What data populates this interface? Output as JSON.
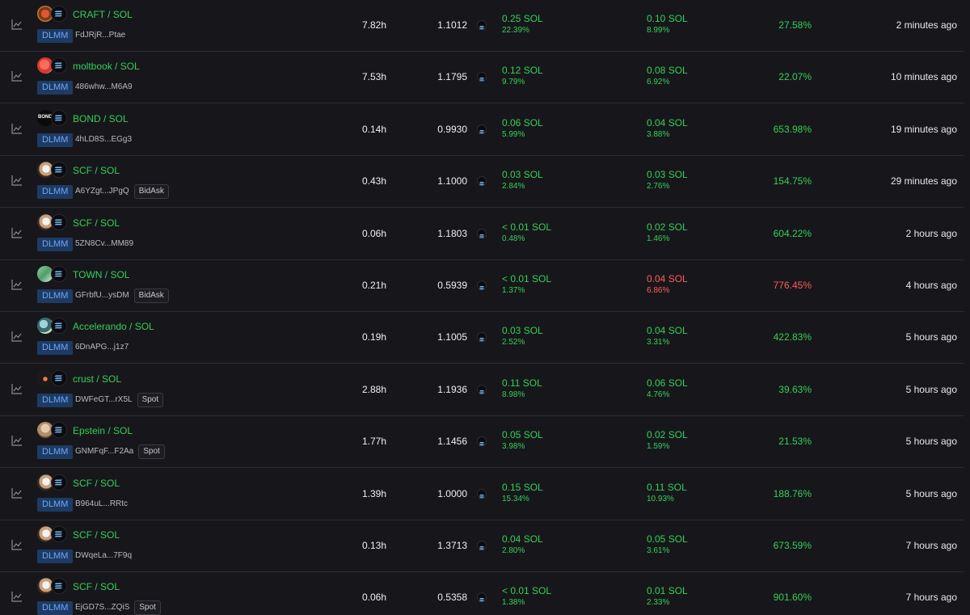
{
  "colors": {
    "background": "#17171b",
    "positive": "#34d058",
    "negative": "#ff5c5c",
    "badge_bg": "#1d3b63",
    "badge_text": "#6ea8ff"
  },
  "rows": [
    {
      "pair": "CRAFT / SOL",
      "token_icon": "craft-token-icon",
      "badge": "DLMM",
      "address": "FdJRjR...Ptae",
      "strategy": "",
      "duration": "7.82h",
      "price": "1.1012",
      "fee": "0.25 SOL",
      "fee_pct": "22.39%",
      "pnl": "0.10 SOL",
      "pnl_pct": "8.99%",
      "pnl_status": "positive",
      "apr": "27.58%",
      "apr_status": "positive",
      "age": "2 minutes ago"
    },
    {
      "pair": "moltbook / SOL",
      "token_icon": "moltbook-token-icon",
      "badge": "DLMM",
      "address": "486whw...M6A9",
      "strategy": "",
      "duration": "7.53h",
      "price": "1.1795",
      "fee": "0.12 SOL",
      "fee_pct": "9.79%",
      "pnl": "0.08 SOL",
      "pnl_pct": "6.92%",
      "pnl_status": "positive",
      "apr": "22.07%",
      "apr_status": "positive",
      "age": "10 minutes ago"
    },
    {
      "pair": "BOND / SOL",
      "token_icon": "bond-token-icon",
      "badge": "DLMM",
      "address": "4hLD8S...EGg3",
      "strategy": "",
      "duration": "0.14h",
      "price": "0.9930",
      "fee": "0.06 SOL",
      "fee_pct": "5.99%",
      "pnl": "0.04 SOL",
      "pnl_pct": "3.88%",
      "pnl_status": "positive",
      "apr": "653.98%",
      "apr_status": "positive",
      "age": "19 minutes ago"
    },
    {
      "pair": "SCF / SOL",
      "token_icon": "scf-token-icon",
      "badge": "DLMM",
      "address": "A6YZgt...JPgQ",
      "strategy": "BidAsk",
      "duration": "0.43h",
      "price": "1.1000",
      "fee": "0.03 SOL",
      "fee_pct": "2.84%",
      "pnl": "0.03 SOL",
      "pnl_pct": "2.76%",
      "pnl_status": "positive",
      "apr": "154.75%",
      "apr_status": "positive",
      "age": "29 minutes ago"
    },
    {
      "pair": "SCF / SOL",
      "token_icon": "scf-token-icon",
      "badge": "DLMM",
      "address": "5ZN8Cv...MM89",
      "strategy": "",
      "duration": "0.06h",
      "price": "1.1803",
      "fee": "< 0.01 SOL",
      "fee_pct": "0.48%",
      "pnl": "0.02 SOL",
      "pnl_pct": "1.46%",
      "pnl_status": "positive",
      "apr": "604.22%",
      "apr_status": "positive",
      "age": "2 hours ago"
    },
    {
      "pair": "TOWN / SOL",
      "token_icon": "town-token-icon",
      "badge": "DLMM",
      "address": "GFrbfU...ysDM",
      "strategy": "BidAsk",
      "duration": "0.21h",
      "price": "0.5939",
      "fee": "< 0.01 SOL",
      "fee_pct": "1.37%",
      "pnl": "0.04 SOL",
      "pnl_pct": "6.86%",
      "pnl_status": "negative",
      "apr": "776.45%",
      "apr_status": "negative",
      "age": "4 hours ago"
    },
    {
      "pair": "Accelerando / SOL",
      "token_icon": "accelerando-token-icon",
      "badge": "DLMM",
      "address": "6DnAPG...j1z7",
      "strategy": "",
      "duration": "0.19h",
      "price": "1.1005",
      "fee": "0.03 SOL",
      "fee_pct": "2.52%",
      "pnl": "0.04 SOL",
      "pnl_pct": "3.31%",
      "pnl_status": "positive",
      "apr": "422.83%",
      "apr_status": "positive",
      "age": "5 hours ago"
    },
    {
      "pair": "crust / SOL",
      "token_icon": "crust-token-icon",
      "badge": "DLMM",
      "address": "DWFeGT...rX5L",
      "strategy": "Spot",
      "duration": "2.88h",
      "price": "1.1936",
      "fee": "0.11 SOL",
      "fee_pct": "8.98%",
      "pnl": "0.06 SOL",
      "pnl_pct": "4.76%",
      "pnl_status": "positive",
      "apr": "39.63%",
      "apr_status": "positive",
      "age": "5 hours ago"
    },
    {
      "pair": "Epstein / SOL",
      "token_icon": "epstein-token-icon",
      "badge": "DLMM",
      "address": "GNMFqF...F2Aa",
      "strategy": "Spot",
      "duration": "1.77h",
      "price": "1.1456",
      "fee": "0.05 SOL",
      "fee_pct": "3.98%",
      "pnl": "0.02 SOL",
      "pnl_pct": "1.59%",
      "pnl_status": "positive",
      "apr": "21.53%",
      "apr_status": "positive",
      "age": "5 hours ago"
    },
    {
      "pair": "SCF / SOL",
      "token_icon": "scf-token-icon",
      "badge": "DLMM",
      "address": "B964uL...RRtc",
      "strategy": "",
      "duration": "1.39h",
      "price": "1.0000",
      "fee": "0.15 SOL",
      "fee_pct": "15.34%",
      "pnl": "0.11 SOL",
      "pnl_pct": "10.93%",
      "pnl_status": "positive",
      "apr": "188.76%",
      "apr_status": "positive",
      "age": "5 hours ago"
    },
    {
      "pair": "SCF / SOL",
      "token_icon": "scf-token-icon",
      "badge": "DLMM",
      "address": "DWqeLa...7F9q",
      "strategy": "",
      "duration": "0.13h",
      "price": "1.3713",
      "fee": "0.04 SOL",
      "fee_pct": "2.80%",
      "pnl": "0.05 SOL",
      "pnl_pct": "3.61%",
      "pnl_status": "positive",
      "apr": "673.59%",
      "apr_status": "positive",
      "age": "7 hours ago"
    },
    {
      "pair": "SCF / SOL",
      "token_icon": "scf-token-icon",
      "badge": "DLMM",
      "address": "EjGD7S...ZQiS",
      "strategy": "Spot",
      "duration": "0.06h",
      "price": "0.5358",
      "fee": "< 0.01 SOL",
      "fee_pct": "1.38%",
      "pnl": "0.01 SOL",
      "pnl_pct": "2.33%",
      "pnl_status": "positive",
      "apr": "901.60%",
      "apr_status": "positive",
      "age": "7 hours ago"
    }
  ]
}
